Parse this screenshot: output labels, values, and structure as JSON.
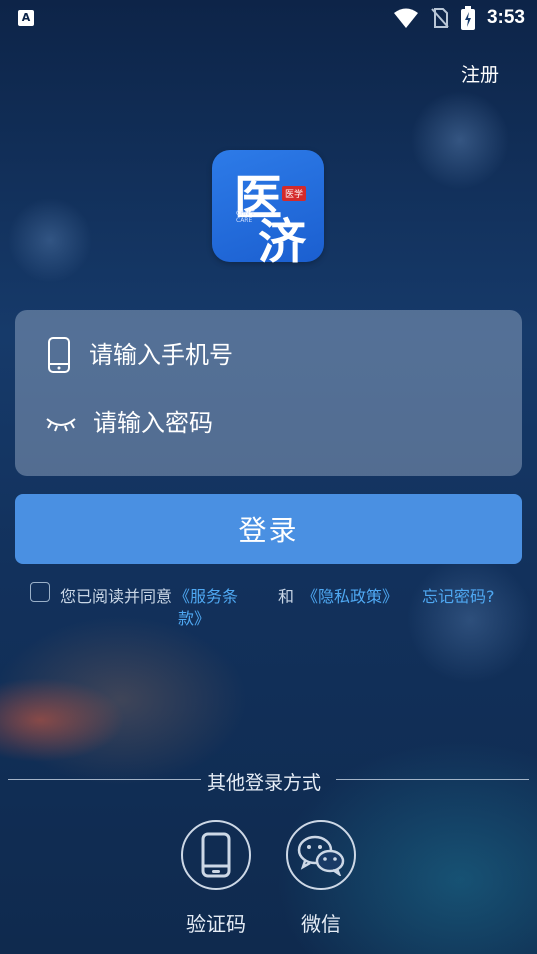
{
  "status_bar": {
    "app_icon_letter": "A",
    "time": "3:53"
  },
  "header": {
    "register_label": "注册"
  },
  "logo": {
    "char_1": "医",
    "char_2": "济",
    "stamp": "医学",
    "tiny_text": "CHN T\nCARE"
  },
  "form": {
    "phone_placeholder": "请输入手机号",
    "password_placeholder": "请输入密码"
  },
  "login_button_label": "登录",
  "agreement": {
    "prefix": "您已阅读并同意",
    "terms_line1": "《服务条",
    "terms_line2": "款》",
    "and": "和",
    "privacy": "《隐私政策》",
    "forgot": "忘记密码?"
  },
  "other_login": {
    "title": "其他登录方式",
    "options": [
      {
        "label": "验证码",
        "icon": "phone-icon"
      },
      {
        "label": "微信",
        "icon": "wechat-icon"
      }
    ]
  },
  "colors": {
    "accent": "#4a90e2",
    "link": "#4fa8f2"
  }
}
